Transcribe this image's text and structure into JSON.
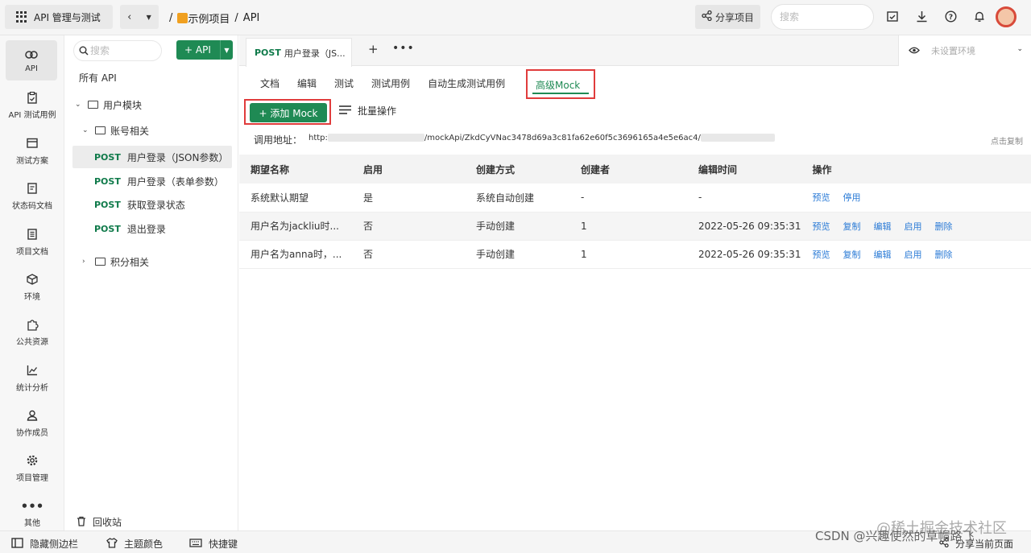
{
  "topbar": {
    "app_title": "API 管理与测试",
    "breadcrumb": [
      "/",
      "示例项目",
      "/",
      "API"
    ],
    "share_label": "分享项目",
    "search_placeholder": "搜索"
  },
  "leftnav": {
    "items": [
      {
        "label": "API",
        "icon": "link-icon"
      },
      {
        "label": "API 测试用例",
        "icon": "clipboard-icon"
      },
      {
        "label": "测试方案",
        "icon": "calendar-icon"
      },
      {
        "label": "状态码文档",
        "icon": "doc-icon"
      },
      {
        "label": "项目文档",
        "icon": "file-icon"
      },
      {
        "label": "环境",
        "icon": "cube-icon"
      },
      {
        "label": "公共资源",
        "icon": "puzzle-icon"
      },
      {
        "label": "统计分析",
        "icon": "chart-icon"
      },
      {
        "label": "协作成员",
        "icon": "user-icon"
      },
      {
        "label": "项目管理",
        "icon": "gear-icon"
      },
      {
        "label": "其他",
        "icon": "more-icon"
      }
    ]
  },
  "tree": {
    "search_placeholder": "搜索",
    "add_label": "+ API",
    "all_label": "所有 API",
    "user_module": "用户模块",
    "account_group": "账号相关",
    "apis": [
      {
        "method": "POST",
        "name": "用户登录（JSON参数）"
      },
      {
        "method": "POST",
        "name": "用户登录（表单参数）"
      },
      {
        "method": "POST",
        "name": "获取登录状态"
      },
      {
        "method": "POST",
        "name": "退出登录"
      }
    ],
    "points_group": "积分相关",
    "trash_label": "回收站"
  },
  "tabs": {
    "active_method": "POST",
    "active_title": "用户登录（JS...",
    "env_placeholder": "未设置环境"
  },
  "subtabs": [
    "文档",
    "编辑",
    "测试",
    "测试用例",
    "自动生成测试用例"
  ],
  "subtab_active": "高级Mock",
  "toolbar": {
    "add_mock": "+ 添加 Mock",
    "batch": "批量操作"
  },
  "url": {
    "label": "调用地址：",
    "prefix": "http:",
    "middle": "/mockApi/ZkdCyVNac3478d69a3c81fa62e60f5c3696165a4e5e6ac4/",
    "copy": "点击复制"
  },
  "table": {
    "headers": [
      "期望名称",
      "启用",
      "创建方式",
      "创建者",
      "编辑时间",
      "操作"
    ],
    "rows": [
      {
        "name": "系统默认期望",
        "enabled": "是",
        "method": "系统自动创建",
        "creator": "-",
        "time": "-",
        "ops": [
          "预览",
          "停用"
        ]
      },
      {
        "name": "用户名为jackliu时...",
        "enabled": "否",
        "method": "手动创建",
        "creator": "1",
        "time": "2022-05-26 09:35:31",
        "ops": [
          "预览",
          "复制",
          "编辑",
          "启用",
          "删除"
        ]
      },
      {
        "name": "用户名为anna时，...",
        "enabled": "否",
        "method": "手动创建",
        "creator": "1",
        "time": "2022-05-26 09:35:31",
        "ops": [
          "预览",
          "复制",
          "编辑",
          "启用",
          "删除"
        ]
      }
    ]
  },
  "bottombar": {
    "hide_sidebar": "隐藏侧边栏",
    "theme": "主题颜色",
    "shortcuts": "快捷键",
    "share_page": "分享当前页面"
  },
  "watermark": {
    "csdn": "CSDN @兴趣使然的草帽路飞",
    "juejin": "@稀土掘金技术社区"
  }
}
